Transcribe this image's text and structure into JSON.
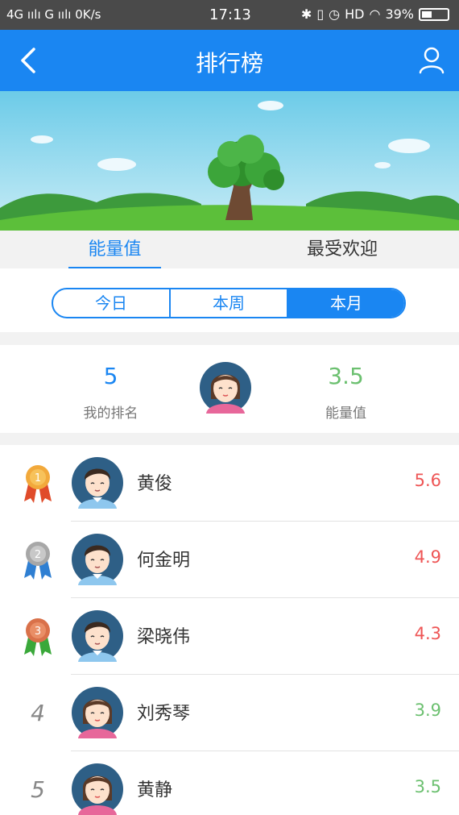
{
  "status_bar": {
    "left": "4G ıılı G ıılı 0K/s",
    "time": "17:13",
    "hd": "HD",
    "battery": "39%"
  },
  "header": {
    "title": "排行榜"
  },
  "tabs": [
    "能量值",
    "最受欢迎"
  ],
  "periods": [
    "今日",
    "本周",
    "本月"
  ],
  "me": {
    "rank": "5",
    "rank_label": "我的排名",
    "value": "3.5",
    "value_label": "能量值"
  },
  "ranking": [
    {
      "rank": "1",
      "name": "黄俊",
      "score": "5.6"
    },
    {
      "rank": "2",
      "name": "何金明",
      "score": "4.9"
    },
    {
      "rank": "3",
      "name": "梁晓伟",
      "score": "4.3"
    },
    {
      "rank": "4",
      "name": "刘秀琴",
      "score": "3.9"
    },
    {
      "rank": "5",
      "name": "黄静",
      "score": "3.5"
    }
  ],
  "colors": {
    "primary": "#1a86f2",
    "red": "#ee5555",
    "green": "#6cc070"
  }
}
